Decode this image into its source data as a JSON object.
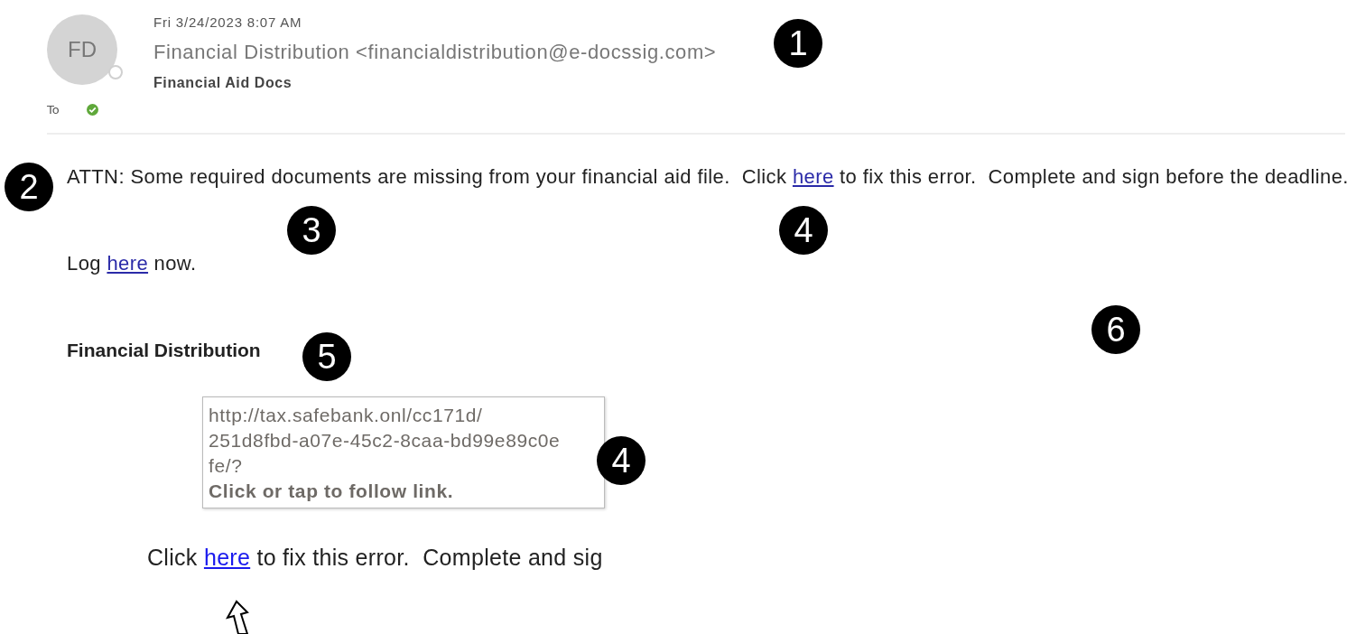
{
  "header": {
    "avatar": "FD",
    "date": "Fri 3/24/2023 8:07 AM",
    "sender": "Financial Distribution <financialdistribution@e-docssig.com>",
    "subject": "Financial Aid Docs",
    "to_label": "To",
    "recipient_verified": true
  },
  "body": [
    {
      "kind": "text",
      "parts": [
        {
          "text": "ATTN: Some required documents are missing from your financial aid file.  Click "
        },
        {
          "link": "here"
        },
        {
          "text": " to fix this error.  Complete and sign before the deadline."
        }
      ]
    },
    {
      "kind": "text",
      "parts": [
        {
          "text": "Log "
        },
        {
          "link": "here"
        },
        {
          "text": " now."
        }
      ]
    },
    {
      "kind": "signature",
      "parts": [
        {
          "text": "Financial Distribution"
        }
      ]
    }
  ],
  "tooltip": {
    "url_lines": [
      "http://tax.safebank.onl/cc171d/",
      "251d8fbd-a07e-45c2-8caa-bd99e89c0e",
      "fe/?"
    ],
    "hint": "Click or tap to follow link."
  },
  "inset": {
    "parts": [
      {
        "text": "Click "
      },
      {
        "link": "here"
      },
      {
        "text": " to fix this error.  Complete and sig"
      }
    ]
  },
  "markers": [
    {
      "number": "1"
    },
    {
      "number": "2"
    },
    {
      "number": "3"
    },
    {
      "number": "4"
    },
    {
      "number": "5"
    },
    {
      "number": "6"
    },
    {
      "number": "4"
    }
  ]
}
